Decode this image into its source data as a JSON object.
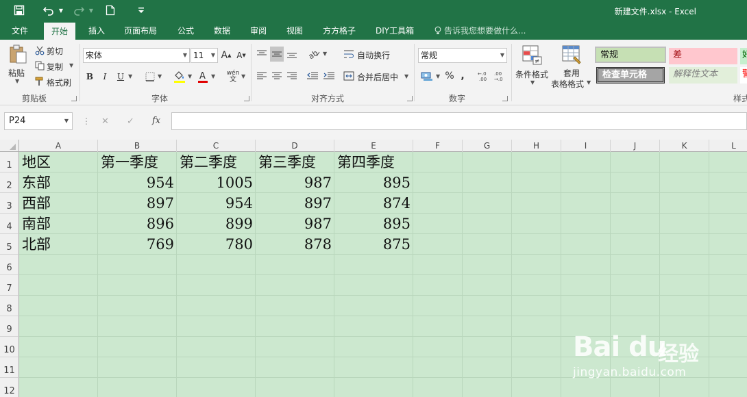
{
  "window": {
    "title": "新建文件.xlsx - Excel"
  },
  "quick_access": {
    "save_icon": "save-icon",
    "undo_icon": "undo-icon",
    "redo_icon": "redo-icon",
    "new_icon": "new-file-icon",
    "customize_icon": "customize-icon"
  },
  "tabs": [
    "文件",
    "开始",
    "插入",
    "页面布局",
    "公式",
    "数据",
    "审阅",
    "视图",
    "方方格子",
    "DIY工具箱"
  ],
  "active_tab": "开始",
  "tell_me": "告诉我您想要做什么...",
  "ribbon": {
    "clipboard": {
      "paste": "粘贴",
      "cut": "剪切",
      "copy": "复制",
      "format_painter": "格式刷",
      "label": "剪贴板"
    },
    "font": {
      "name": "宋体",
      "size": "11",
      "grow": "A",
      "shrink": "A",
      "bold": "B",
      "italic": "I",
      "underline": "U",
      "phonetic": "wén",
      "label": "字体"
    },
    "alignment": {
      "wrap": "自动换行",
      "merge": "合并后居中",
      "label": "对齐方式"
    },
    "number": {
      "format": "常规",
      "percent": "%",
      "comma": ",",
      "label": "数字"
    },
    "styles": {
      "conditional": "条件格式",
      "table_line1": "套用",
      "table_line2": "表格格式",
      "cells": [
        {
          "text": "常规",
          "bg": "#c6e0b4",
          "color": "#111111"
        },
        {
          "text": "差",
          "bg": "#ffc7ce",
          "color": "#9c0006"
        },
        {
          "text": "好",
          "bg": "#c6efce",
          "color": "#006100"
        },
        {
          "text": "检查单元格",
          "bg": "#a5a5a5",
          "color": "#ffffff"
        },
        {
          "text": "解释性文本",
          "bg": "#e2efda",
          "color": "#7f7f7f"
        },
        {
          "text": "警",
          "bg": "#ffffff",
          "color": "#ff0000"
        }
      ],
      "label": "样式"
    }
  },
  "formula_bar": {
    "name_box": "P24",
    "cancel": "✕",
    "enter": "✓",
    "fx": "fx",
    "value": ""
  },
  "sheet": {
    "columns": [
      "A",
      "B",
      "C",
      "D",
      "E",
      "F",
      "G",
      "H",
      "I",
      "J",
      "K",
      "L"
    ],
    "rows": [
      "1",
      "2",
      "3",
      "4",
      "5",
      "6",
      "7",
      "8",
      "9",
      "10",
      "11",
      "12"
    ],
    "cells": [
      [
        "地区",
        "第一季度",
        "第二季度",
        "第三季度",
        "第四季度"
      ],
      [
        "东部",
        "954",
        "1005",
        "987",
        "895"
      ],
      [
        "西部",
        "897",
        "954",
        "897",
        "874"
      ],
      [
        "南部",
        "896",
        "899",
        "987",
        "895"
      ],
      [
        "北部",
        "769",
        "780",
        "878",
        "875"
      ]
    ]
  },
  "colors": {
    "brand": "#217346",
    "sheet_bg": "#cce8cf",
    "ribbon_bg": "#f3f3f3"
  },
  "watermark": {
    "logo": "Bai du",
    "cn": "经验",
    "url": "jingyan.baidu.com"
  }
}
